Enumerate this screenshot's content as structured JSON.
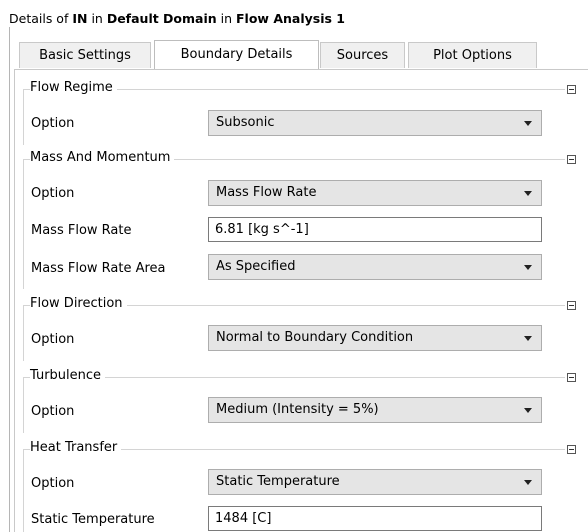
{
  "header": {
    "prefix": "Details of ",
    "object": "IN",
    "in1": " in ",
    "domain": "Default Domain",
    "in2": " in ",
    "analysis": "Flow Analysis 1"
  },
  "tabs": [
    "Basic Settings",
    "Boundary Details",
    "Sources",
    "Plot Options"
  ],
  "active_tab": "Boundary Details",
  "groups": {
    "flow_regime": {
      "title": "Flow Regime",
      "option_label": "Option",
      "option_value": "Subsonic"
    },
    "mass_momentum": {
      "title": "Mass And Momentum",
      "option_label": "Option",
      "option_value": "Mass Flow Rate",
      "rate_label": "Mass Flow Rate",
      "rate_value": "6.81 [kg s^-1]",
      "area_label": "Mass Flow Rate Area",
      "area_value": "As Specified"
    },
    "flow_direction": {
      "title": "Flow Direction",
      "option_label": "Option",
      "option_value": "Normal to Boundary Condition"
    },
    "turbulence": {
      "title": "Turbulence",
      "option_label": "Option",
      "option_value": "Medium (Intensity = 5%)"
    },
    "heat_transfer": {
      "title": "Heat Transfer",
      "option_label": "Option",
      "option_value": "Static Temperature",
      "temp_label": "Static Temperature",
      "temp_value": "1484 [C]"
    }
  },
  "icons": {
    "collapse": "minus-box-icon",
    "dropdown": "chevron-down-icon"
  },
  "colors": {
    "combo_bg": "#e5e5e5",
    "field_bg": "#ffffff",
    "tab_bg": "#f0f0f0"
  }
}
